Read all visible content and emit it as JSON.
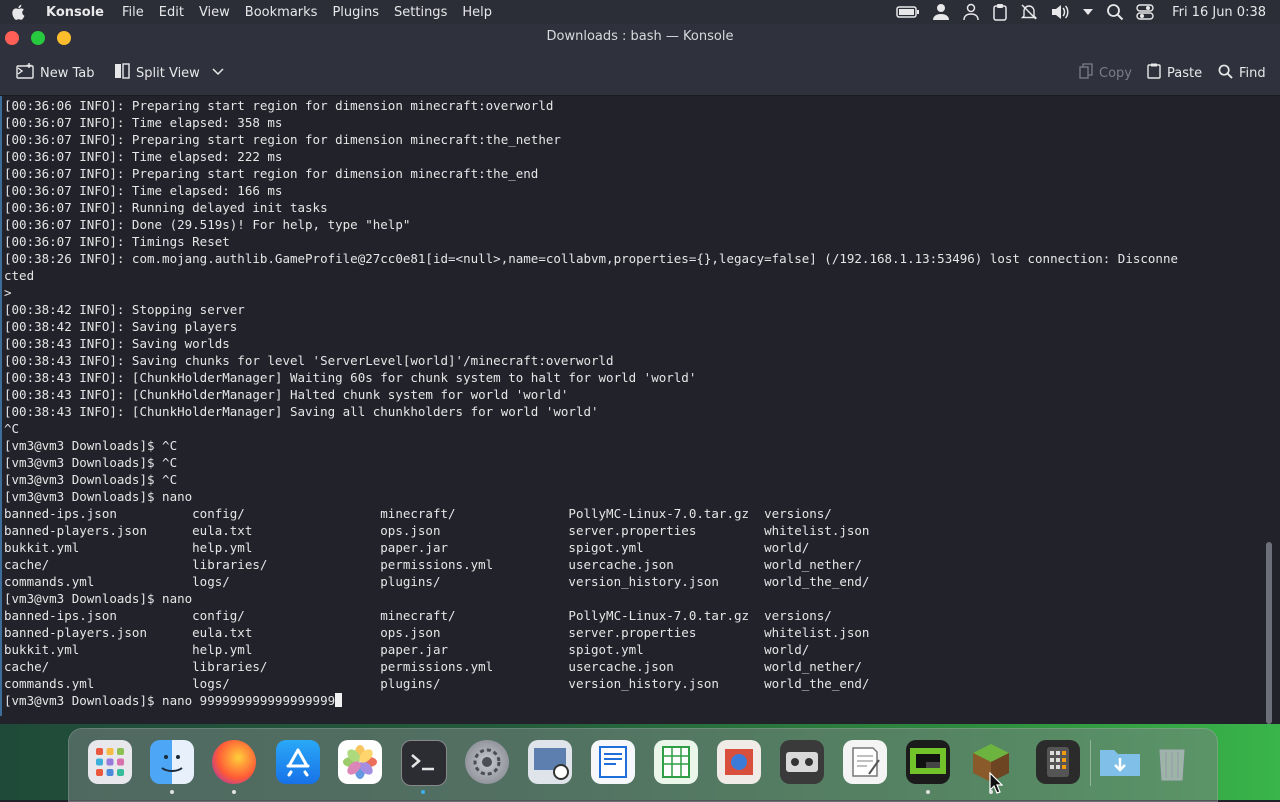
{
  "menubar": {
    "app_name": "Konsole",
    "menus": [
      "File",
      "Edit",
      "View",
      "Bookmarks",
      "Plugins",
      "Settings",
      "Help"
    ],
    "clock": "Fri 16 Jun 0:38"
  },
  "window": {
    "title": "Downloads : bash — Konsole"
  },
  "toolbar": {
    "new_tab_label": "New Tab",
    "split_view_label": "Split View",
    "copy_label": "Copy",
    "paste_label": "Paste",
    "find_label": "Find"
  },
  "terminal": {
    "lines": [
      "[00:36:06 INFO]: Preparing start region for dimension minecraft:overworld",
      "[00:36:07 INFO]: Time elapsed: 358 ms",
      "[00:36:07 INFO]: Preparing start region for dimension minecraft:the_nether",
      "[00:36:07 INFO]: Time elapsed: 222 ms",
      "[00:36:07 INFO]: Preparing start region for dimension minecraft:the_end",
      "[00:36:07 INFO]: Time elapsed: 166 ms",
      "[00:36:07 INFO]: Running delayed init tasks",
      "[00:36:07 INFO]: Done (29.519s)! For help, type \"help\"",
      "[00:36:07 INFO]: Timings Reset",
      "[00:38:26 INFO]: com.mojang.authlib.GameProfile@27cc0e81[id=<null>,name=collabvm,properties={},legacy=false] (/192.168.1.13:53496) lost connection: Disconne",
      "cted",
      ">",
      "[00:38:42 INFO]: Stopping server",
      "[00:38:42 INFO]: Saving players",
      "[00:38:43 INFO]: Saving worlds",
      "[00:38:43 INFO]: Saving chunks for level 'ServerLevel[world]'/minecraft:overworld",
      "[00:38:43 INFO]: [ChunkHolderManager] Waiting 60s for chunk system to halt for world 'world'",
      "[00:38:43 INFO]: [ChunkHolderManager] Halted chunk system for world 'world'",
      "[00:38:43 INFO]: [ChunkHolderManager] Saving all chunkholders for world 'world'",
      "^C",
      "[vm3@vm3 Downloads]$ ^C",
      "[vm3@vm3 Downloads]$ ^C",
      "[vm3@vm3 Downloads]$ ^C",
      "[vm3@vm3 Downloads]$ nano",
      "banned-ips.json          config/                  minecraft/               PollyMC-Linux-7.0.tar.gz  versions/",
      "banned-players.json      eula.txt                 ops.json                 server.properties         whitelist.json",
      "bukkit.yml               help.yml                 paper.jar                spigot.yml                world/",
      "cache/                   libraries/               permissions.yml          usercache.json            world_nether/",
      "commands.yml             logs/                    plugins/                 version_history.json      world_the_end/",
      "[vm3@vm3 Downloads]$ nano",
      "banned-ips.json          config/                  minecraft/               PollyMC-Linux-7.0.tar.gz  versions/",
      "banned-players.json      eula.txt                 ops.json                 server.properties         whitelist.json",
      "bukkit.yml               help.yml                 paper.jar                spigot.yml                world/",
      "cache/                   libraries/               permissions.yml          usercache.json            world_nether/",
      "commands.yml             logs/                    plugins/                 version_history.json      world_the_end/"
    ],
    "prompt_line": "[vm3@vm3 Downloads]$ nano 999999999999999999"
  },
  "dock": {
    "apps": [
      {
        "icon": "launchpad-icon",
        "running": false
      },
      {
        "icon": "finder-icon",
        "running": true
      },
      {
        "icon": "firefox-icon",
        "running": true
      },
      {
        "icon": "app-store-icon",
        "running": false
      },
      {
        "icon": "photos-icon",
        "running": false
      },
      {
        "icon": "terminal-icon",
        "running": true
      },
      {
        "icon": "system-settings-icon",
        "running": false
      },
      {
        "icon": "preview-icon",
        "running": false
      },
      {
        "icon": "pages-icon",
        "running": false
      },
      {
        "icon": "numbers-icon",
        "running": false
      },
      {
        "icon": "image-viewer-icon",
        "running": false
      },
      {
        "icon": "tape-deck-icon",
        "running": false
      },
      {
        "icon": "text-editor-icon",
        "running": false
      },
      {
        "icon": "monitor-icon",
        "running": true
      },
      {
        "icon": "minecraft-icon",
        "running": true
      },
      {
        "icon": "calculator-icon",
        "running": false
      },
      {
        "icon": "downloads-folder-icon",
        "running": false
      },
      {
        "icon": "trash-icon",
        "running": false
      }
    ]
  },
  "colors": {
    "terminal_bg": "#21222a",
    "terminal_fg": "#e6e6e6",
    "chrome_bg": "#2f323c",
    "close": "#ff5f56",
    "minimize": "#27c93f",
    "maximize": "#ffbd2e"
  }
}
